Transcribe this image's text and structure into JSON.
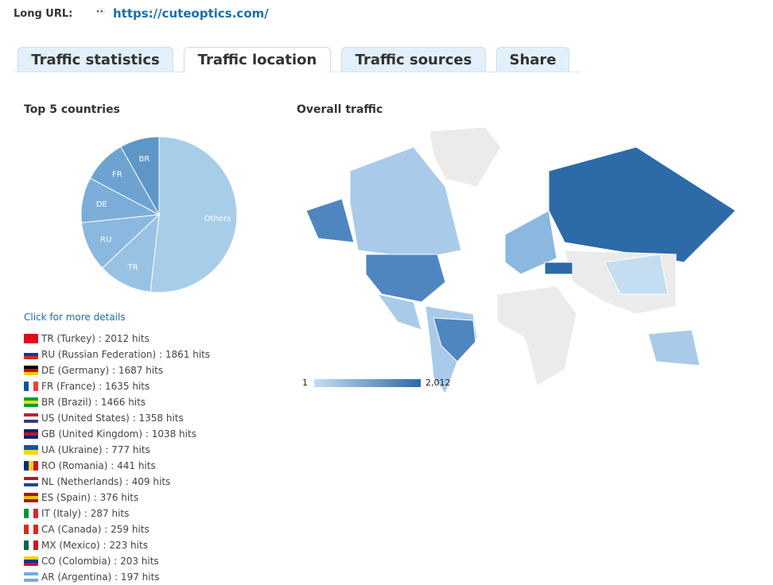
{
  "header": {
    "long_url_label": "Long URL:",
    "url": "https://cuteoptics.com/"
  },
  "tabs": [
    {
      "label": "Traffic statistics"
    },
    {
      "label": "Traffic location",
      "active": true
    },
    {
      "label": "Traffic sources"
    },
    {
      "label": "Share"
    }
  ],
  "top5": {
    "title": "Top 5 countries"
  },
  "map": {
    "title": "Overall traffic",
    "legend_min": "1",
    "legend_max": "2,012"
  },
  "more_link": "Click for more details",
  "countries": [
    {
      "text": "TR (Turkey) : 2012 hits",
      "flag": [
        "#e30a17",
        "#e30a17"
      ]
    },
    {
      "text": "RU (Russian Federation) : 1861 hits",
      "flag": [
        "#ffffff",
        "#0039a6",
        "#d52b1e"
      ]
    },
    {
      "text": "DE (Germany) : 1687 hits",
      "flag": [
        "#000000",
        "#dd0000",
        "#ffce00"
      ]
    },
    {
      "text": "FR (France) : 1635 hits",
      "flag": [
        "#0055a4",
        "#ffffff",
        "#ef4135"
      ],
      "v": true
    },
    {
      "text": "BR (Brazil) : 1466 hits",
      "flag": [
        "#009c3b",
        "#ffdf00",
        "#009c3b"
      ]
    },
    {
      "text": "US (United States) : 1358 hits",
      "flag": [
        "#b22234",
        "#ffffff",
        "#3c3b6e"
      ]
    },
    {
      "text": "GB (United Kingdom) : 1038 hits",
      "flag": [
        "#012169",
        "#c8102e",
        "#012169"
      ]
    },
    {
      "text": "UA (Ukraine) : 777 hits",
      "flag": [
        "#0057b7",
        "#ffd700"
      ]
    },
    {
      "text": "RO (Romania) : 441 hits",
      "flag": [
        "#002b7f",
        "#fcd116",
        "#ce1126"
      ],
      "v": true
    },
    {
      "text": "NL (Netherlands) : 409 hits",
      "flag": [
        "#ae1c28",
        "#ffffff",
        "#21468b"
      ]
    },
    {
      "text": "ES (Spain) : 376 hits",
      "flag": [
        "#aa151b",
        "#f1bf00",
        "#aa151b"
      ]
    },
    {
      "text": "IT (Italy) : 287 hits",
      "flag": [
        "#009246",
        "#ffffff",
        "#ce2b37"
      ],
      "v": true
    },
    {
      "text": "CA (Canada) : 259 hits",
      "flag": [
        "#d52b1e",
        "#ffffff",
        "#d52b1e"
      ],
      "v": true
    },
    {
      "text": "MX (Mexico) : 223 hits",
      "flag": [
        "#006847",
        "#ffffff",
        "#ce1126"
      ],
      "v": true
    },
    {
      "text": "CO (Colombia) : 203 hits",
      "flag": [
        "#fcd116",
        "#003893",
        "#ce1126"
      ]
    },
    {
      "text": "AR (Argentina) : 197 hits",
      "flag": [
        "#74acdf",
        "#ffffff",
        "#74acdf"
      ]
    }
  ],
  "chart_data": {
    "type": "pie",
    "title": "Top 5 countries",
    "slices": [
      {
        "label": "Others",
        "value": 9300,
        "color": "#a8cde9"
      },
      {
        "label": "TR",
        "value": 2012,
        "color": "#98c2e4"
      },
      {
        "label": "RU",
        "value": 1861,
        "color": "#8ab8df"
      },
      {
        "label": "DE",
        "value": 1687,
        "color": "#7cadd8"
      },
      {
        "label": "FR",
        "value": 1635,
        "color": "#6ea3d1"
      },
      {
        "label": "BR",
        "value": 1466,
        "color": "#5e96c7"
      }
    ]
  }
}
